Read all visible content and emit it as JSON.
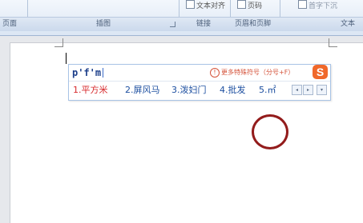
{
  "ribbon": {
    "top_buttons": [
      {
        "label": "文本对齐",
        "icon": "cross-reference-icon"
      },
      {
        "label": "页码",
        "icon": "page-number-icon"
      },
      {
        "label": "首字下沉",
        "icon": "dropcap-icon"
      }
    ],
    "groups": [
      "页面",
      "插图",
      "链接",
      "页眉和页脚",
      "文本"
    ]
  },
  "ime": {
    "pinyin": "p'f'm",
    "hint_icon": "info-circle-icon",
    "hint": "更多特殊符号（分号+F）",
    "logo": "S",
    "candidates": [
      {
        "label": "1.平方米"
      },
      {
        "label": "2.屏风马"
      },
      {
        "label": "3.泼妇门"
      },
      {
        "label": "4.批发"
      },
      {
        "label": "5.㎡"
      }
    ],
    "nav": {
      "prev": "◂",
      "next": "▸",
      "expand": "▾"
    },
    "highlight_color": "#931c1c"
  }
}
